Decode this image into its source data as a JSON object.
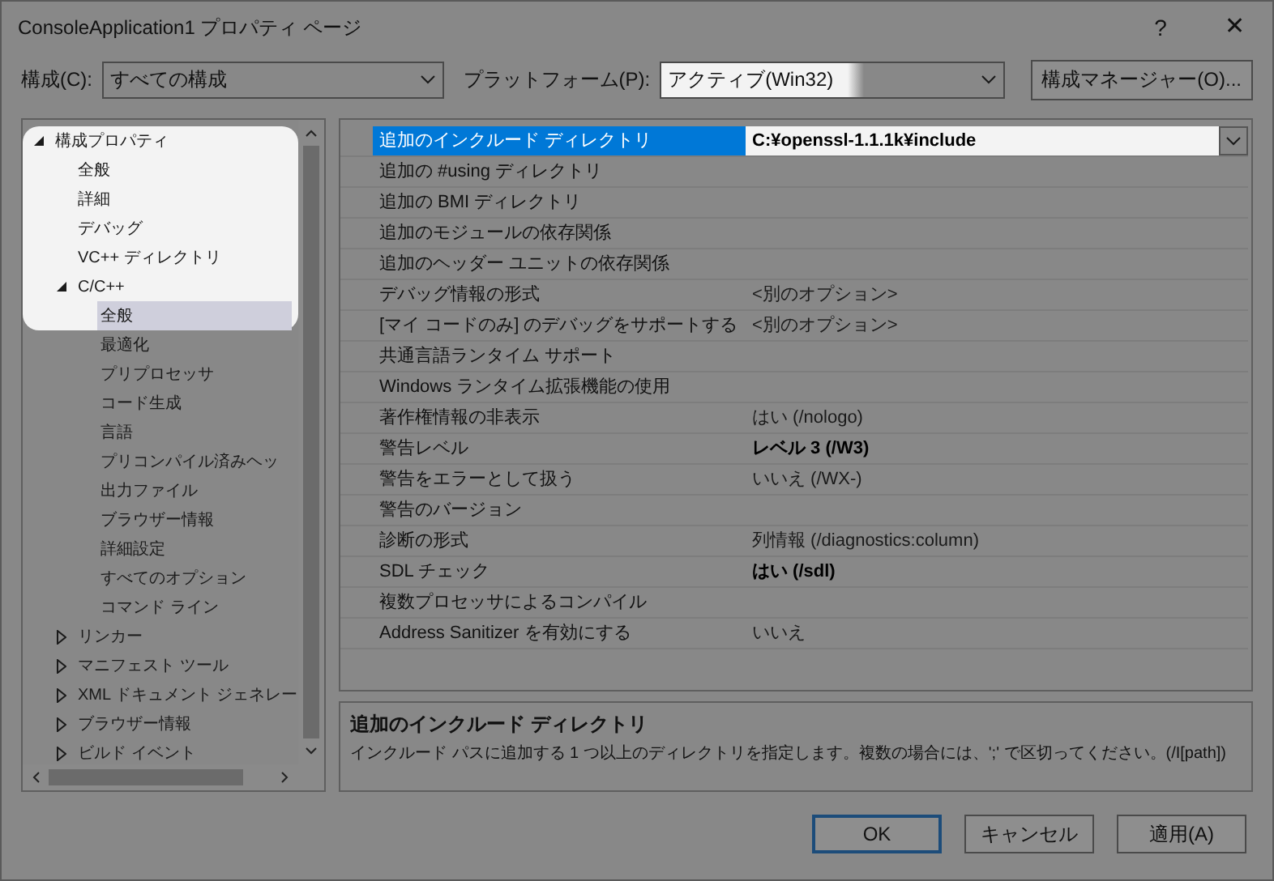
{
  "window": {
    "title": "ConsoleApplication1 プロパティ ページ",
    "help": "?",
    "close": "✕"
  },
  "toolbar": {
    "configuration_label": "構成(C):",
    "configuration": "すべての構成",
    "platform_label": "プラットフォーム(P):",
    "platform": "アクティブ(Win32)",
    "platform_highlighted": true,
    "manager_button": "構成マネージャー(O)..."
  },
  "tree": [
    {
      "label": "構成プロパティ",
      "expanded": true,
      "selected": false,
      "highlighted": true,
      "children": [
        {
          "label": "全般",
          "selected": false,
          "highlighted": true
        },
        {
          "label": "詳細",
          "selected": false,
          "highlighted": true
        },
        {
          "label": "デバッグ",
          "selected": false,
          "highlighted": true
        },
        {
          "label": "VC++ ディレクトリ",
          "selected": false,
          "highlighted": true
        },
        {
          "label": "C/C++",
          "expanded": true,
          "selected": false,
          "highlighted": true,
          "children": [
            {
              "label": "全般",
              "selected": true,
              "highlighted": true
            },
            {
              "label": "最適化",
              "selected": false,
              "highlighted": false
            },
            {
              "label": "プリプロセッサ",
              "selected": false,
              "highlighted": false
            },
            {
              "label": "コード生成",
              "selected": false,
              "highlighted": false
            },
            {
              "label": "言語",
              "selected": false,
              "highlighted": false
            },
            {
              "label": "プリコンパイル済みヘッ",
              "selected": false,
              "highlighted": false
            },
            {
              "label": "出力ファイル",
              "selected": false,
              "highlighted": false
            },
            {
              "label": "ブラウザー情報",
              "selected": false,
              "highlighted": false
            },
            {
              "label": "詳細設定",
              "selected": false,
              "highlighted": false
            },
            {
              "label": "すべてのオプション",
              "selected": false,
              "highlighted": false
            },
            {
              "label": "コマンド ライン",
              "selected": false,
              "highlighted": false
            }
          ]
        },
        {
          "label": "リンカー",
          "expanded": false,
          "selected": false,
          "highlighted": false
        },
        {
          "label": "マニフェスト ツール",
          "expanded": false,
          "selected": false,
          "highlighted": false
        },
        {
          "label": "XML ドキュメント ジェネレー",
          "expanded": false,
          "selected": false,
          "highlighted": false
        },
        {
          "label": "ブラウザー情報",
          "expanded": false,
          "selected": false,
          "highlighted": false
        },
        {
          "label": "ビルド イベント",
          "expanded": false,
          "selected": false,
          "highlighted": false
        }
      ]
    }
  ],
  "properties": [
    {
      "name": "追加のインクルード ディレクトリ",
      "value": "C:¥openssl-1.1.1k¥include",
      "selected": true,
      "bold": true
    },
    {
      "name": "追加の #using ディレクトリ",
      "selected": false
    },
    {
      "name": "追加の BMI ディレクトリ",
      "selected": false
    },
    {
      "name": "追加のモジュールの依存関係",
      "selected": false
    },
    {
      "name": "追加のヘッダー ユニットの依存関係",
      "selected": false
    },
    {
      "name": "デバッグ情報の形式",
      "value": "<別のオプション>",
      "selected": false,
      "bold": false
    },
    {
      "name": "[マイ コードのみ] のデバッグをサポートする",
      "value": "<別のオプション>",
      "selected": false,
      "bold": false
    },
    {
      "name": "共通言語ランタイム サポート",
      "selected": false
    },
    {
      "name": "Windows ランタイム拡張機能の使用",
      "selected": false
    },
    {
      "name": "著作権情報の非表示",
      "value": "はい (/nologo)",
      "selected": false,
      "bold": false
    },
    {
      "name": "警告レベル",
      "value": "レベル 3 (/W3)",
      "selected": false,
      "bold": true
    },
    {
      "name": "警告をエラーとして扱う",
      "value": "いいえ (/WX-)",
      "selected": false,
      "bold": false
    },
    {
      "name": "警告のバージョン",
      "selected": false
    },
    {
      "name": "診断の形式",
      "value": "列情報 (/diagnostics:column)",
      "selected": false,
      "bold": false
    },
    {
      "name": "SDL チェック",
      "value": "はい (/sdl)",
      "selected": false,
      "bold": true
    },
    {
      "name": "複数プロセッサによるコンパイル",
      "selected": false
    },
    {
      "name": "Address Sanitizer を有効にする",
      "value": "いいえ",
      "selected": false,
      "bold": false
    }
  ],
  "description": {
    "title": "追加のインクルード ディレクトリ",
    "text": "インクルード パスに追加する 1 つ以上のディレクトリを指定します。複数の場合には、';' で区切ってください。(/I[path])"
  },
  "buttons": [
    {
      "label": "OK",
      "default": true
    },
    {
      "label": "キャンセル",
      "default": false
    },
    {
      "label": "適用(A)",
      "default": false
    }
  ]
}
